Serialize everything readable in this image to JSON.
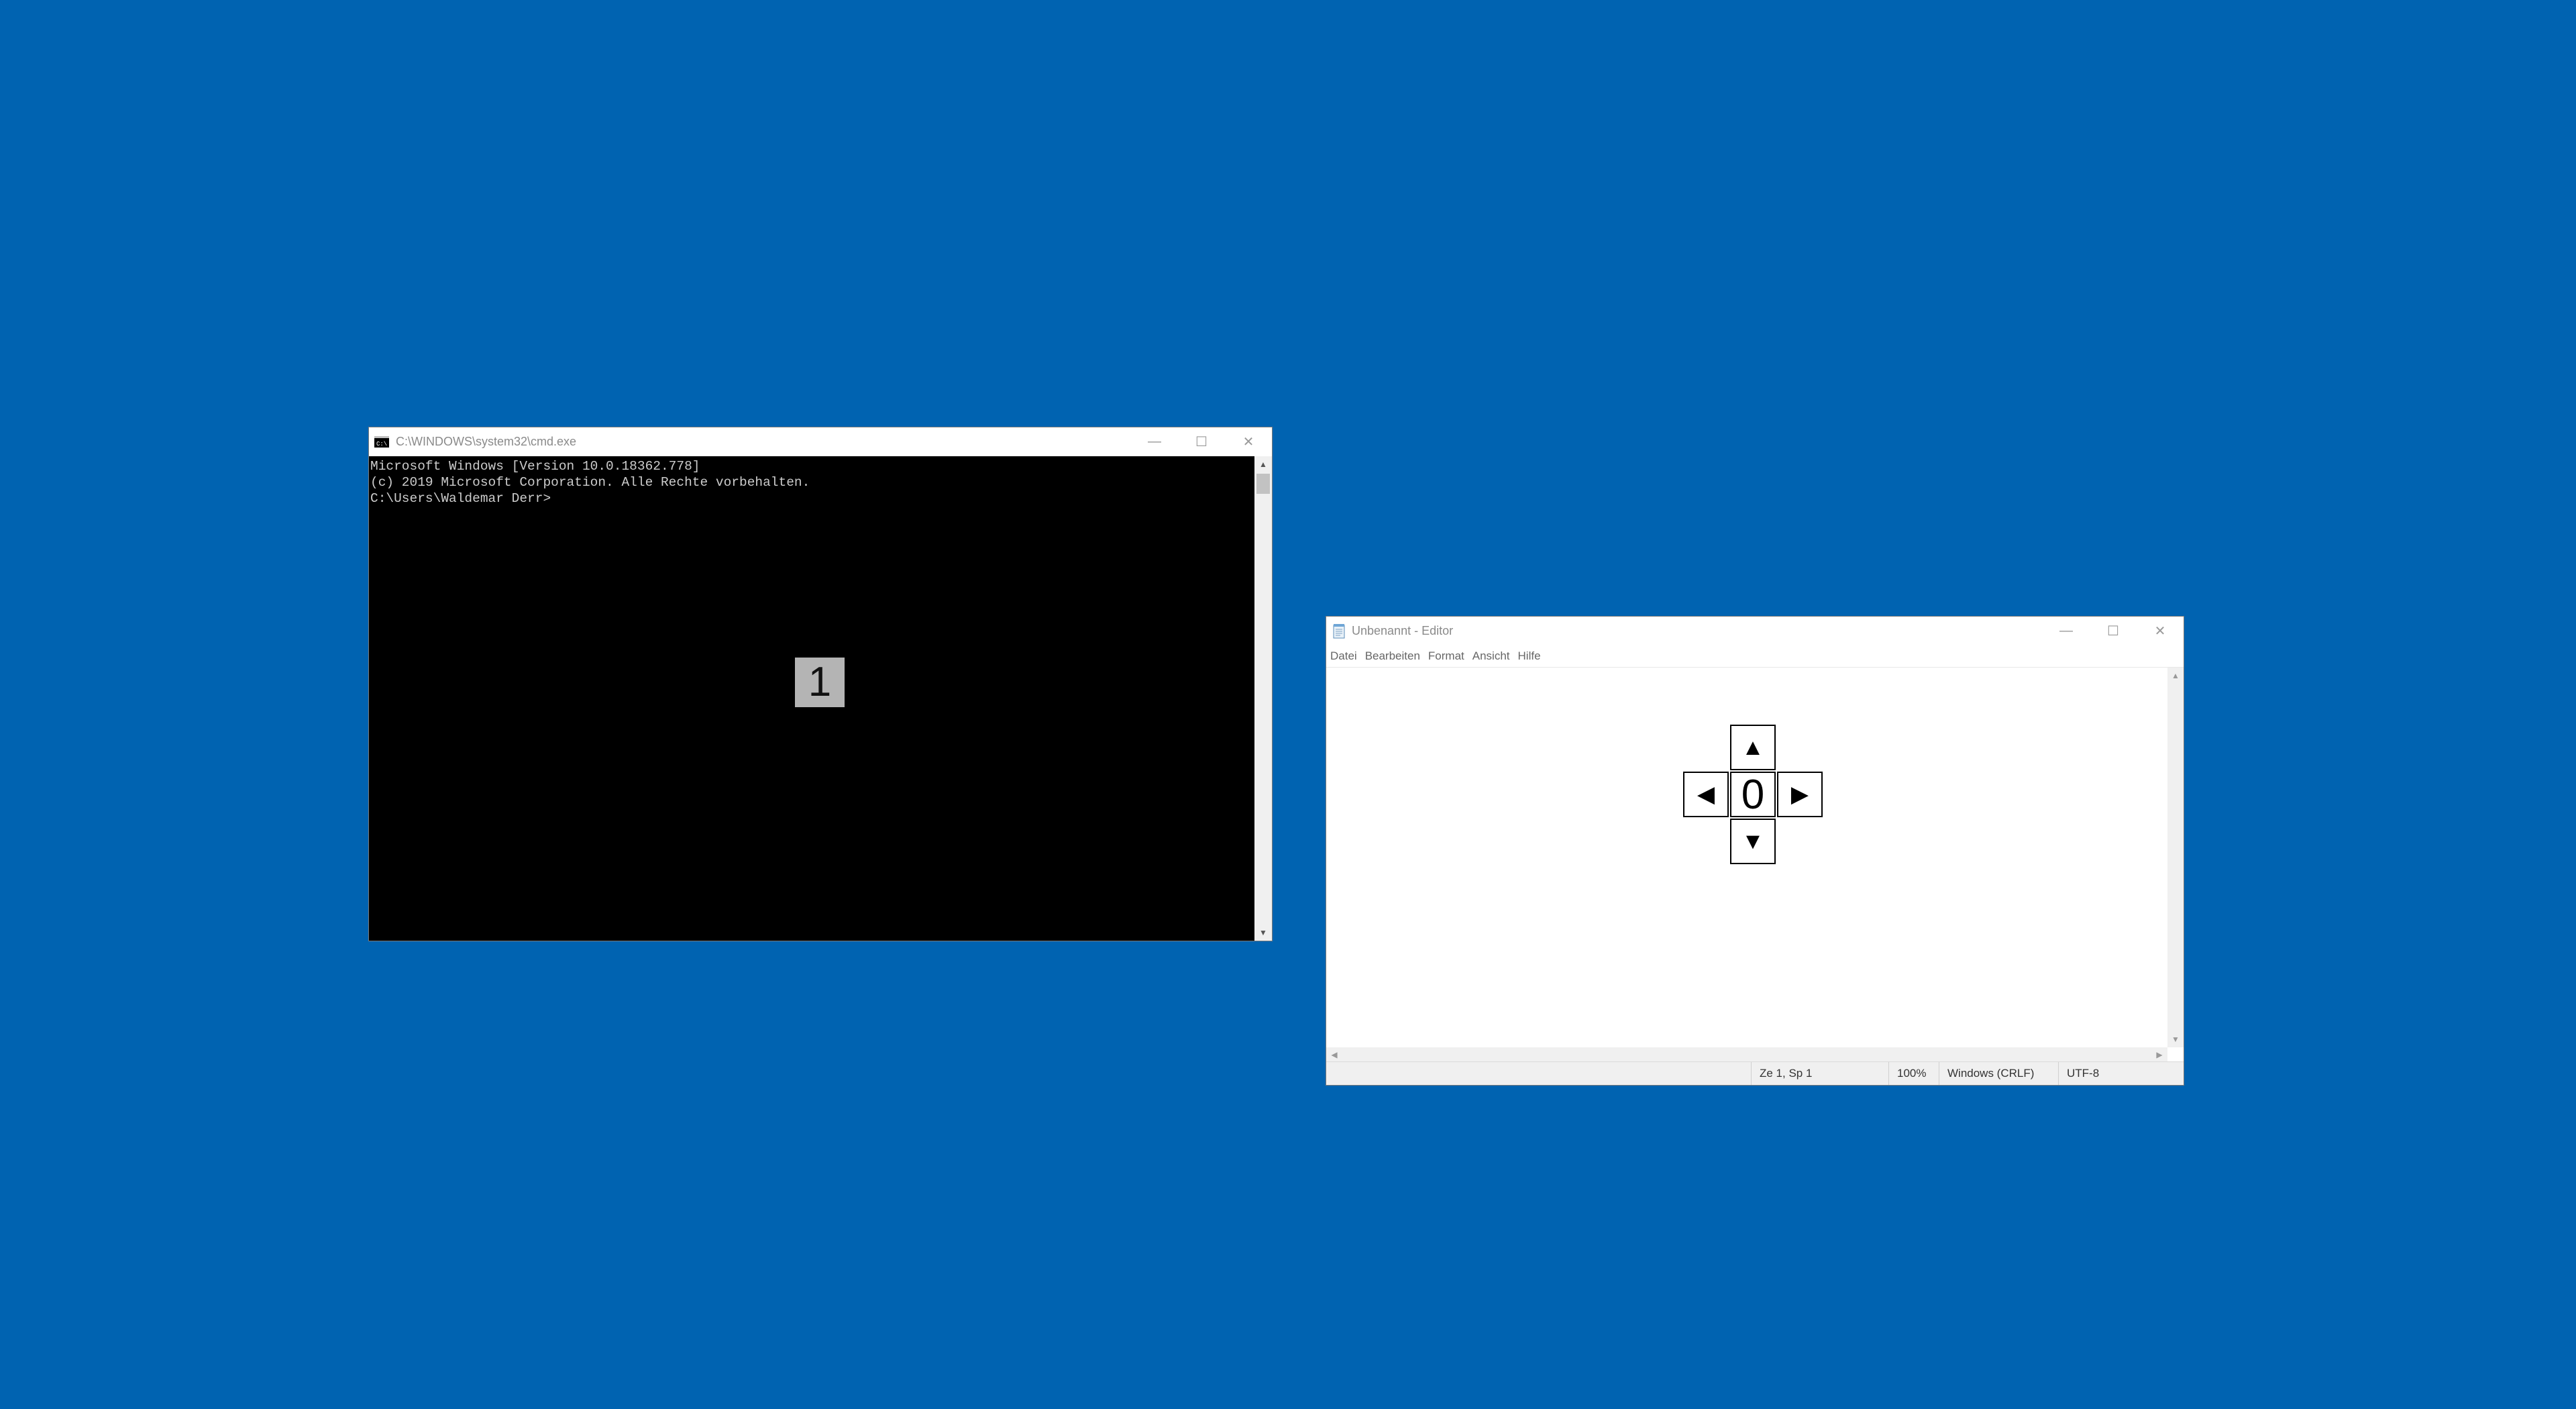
{
  "desktop": {
    "background_color": "#0063b1"
  },
  "cmd_window": {
    "title": "C:\\WINDOWS\\system32\\cmd.exe",
    "icon": "cmd-icon",
    "console_lines": [
      "Microsoft Windows [Version 10.0.18362.778]",
      "(c) 2019 Microsoft Corporation. Alle Rechte vorbehalten.",
      "",
      "C:\\Users\\Waldemar Derr>"
    ],
    "badge": "1"
  },
  "notepad_window": {
    "title": "Unbenannt - Editor",
    "icon": "notepad-icon",
    "menu": [
      "Datei",
      "Bearbeiten",
      "Format",
      "Ansicht",
      "Hilfe"
    ],
    "dpad": {
      "up": "▲",
      "down": "▼",
      "left": "◀",
      "right": "▶",
      "center": "0"
    },
    "status": {
      "position": "Ze 1, Sp 1",
      "zoom": "100%",
      "line_endings": "Windows (CRLF)",
      "encoding": "UTF-8"
    }
  },
  "caption_buttons": {
    "minimize": "—",
    "maximize": "☐",
    "close": "✕"
  }
}
